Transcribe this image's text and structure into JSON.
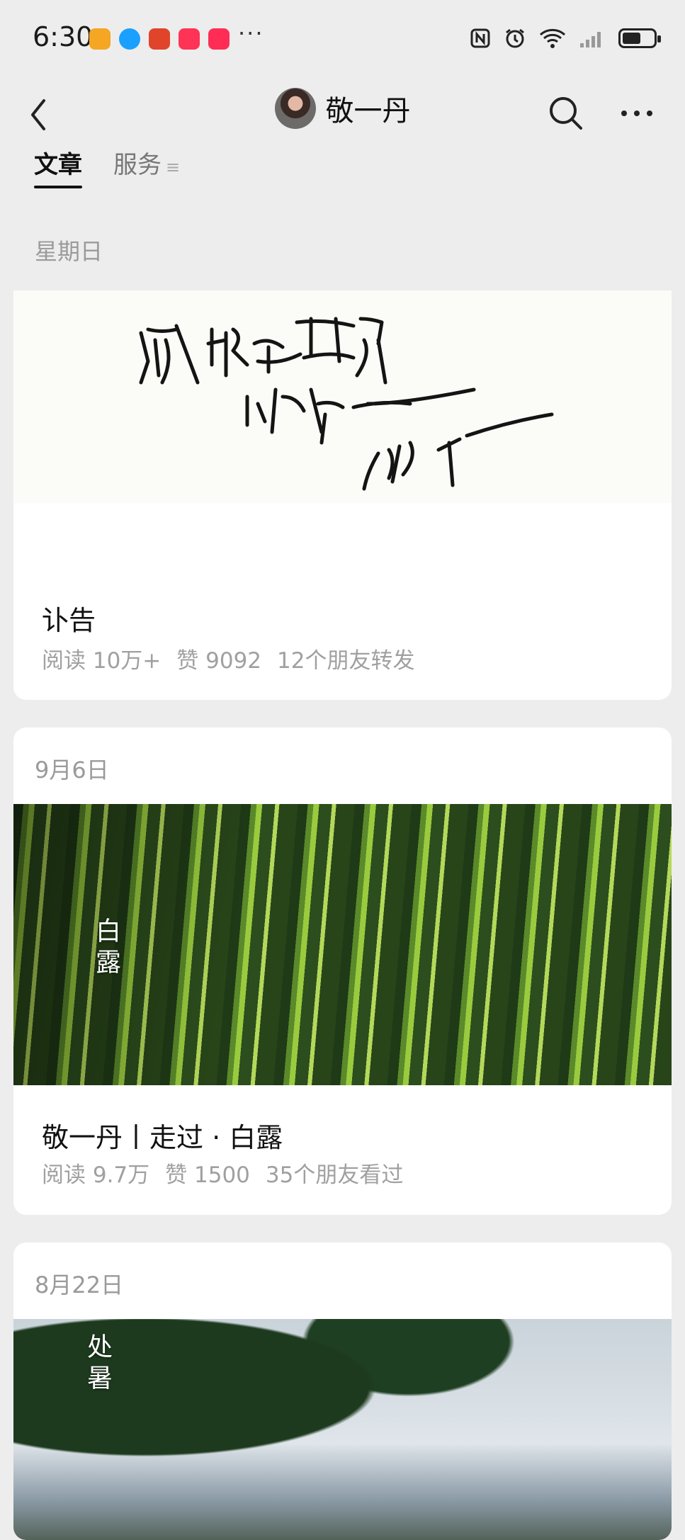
{
  "status_bar": {
    "time": "6:30",
    "more_indicator": "···",
    "battery_level": 0.6,
    "app_icon_colors": [
      "#f5a623",
      "#1aa0ff",
      "#e0452b",
      "#ff3355",
      "#ff2d55"
    ]
  },
  "header": {
    "title": "敬一丹"
  },
  "tabs": {
    "articles": "文章",
    "services": "服务",
    "services_menu_icon": "≡"
  },
  "articles": [
    {
      "date": "星期日",
      "title": "讣告",
      "reads": "阅读 10万+",
      "likes": "赞 9092",
      "social": "12个朋友转发"
    },
    {
      "date": "9月6日",
      "title": "敬一丹丨走过 · 白露",
      "reads": "阅读 9.7万",
      "likes": "赞 1500",
      "social": "35个朋友看过",
      "image_overlay": "白露"
    },
    {
      "date": "8月22日",
      "image_overlay": "处暑"
    }
  ]
}
